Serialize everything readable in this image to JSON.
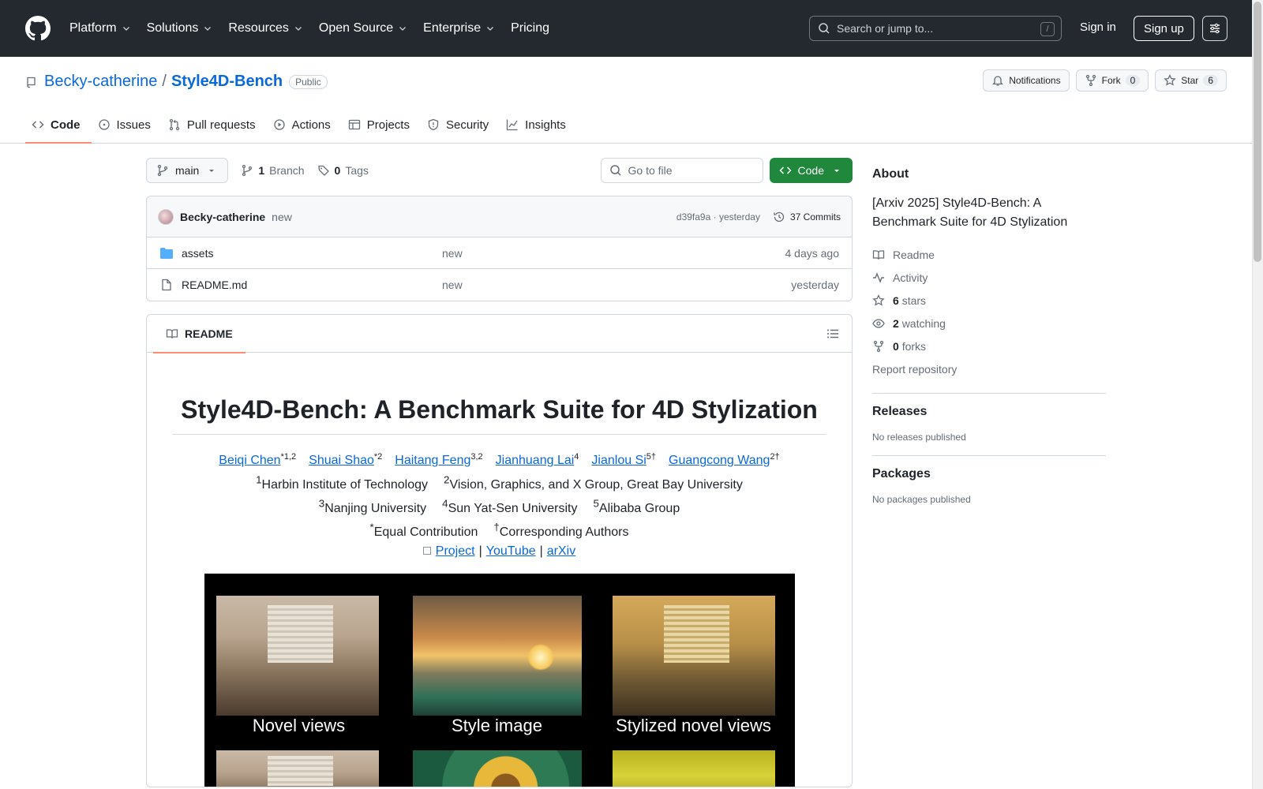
{
  "header": {
    "nav": [
      {
        "label": "Platform",
        "has_menu": true
      },
      {
        "label": "Solutions",
        "has_menu": true
      },
      {
        "label": "Resources",
        "has_menu": true
      },
      {
        "label": "Open Source",
        "has_menu": true
      },
      {
        "label": "Enterprise",
        "has_menu": true
      },
      {
        "label": "Pricing",
        "has_menu": false
      }
    ],
    "search_placeholder": "Search or jump to...",
    "search_shortcut": "/",
    "sign_in": "Sign in",
    "sign_up": "Sign up"
  },
  "repo": {
    "owner": "Becky-catherine",
    "separator": "/",
    "name": "Style4D-Bench",
    "visibility": "Public",
    "notifications_label": "Notifications",
    "fork_label": "Fork",
    "fork_count": "0",
    "star_label": "Star",
    "star_count": "6",
    "tabs": [
      {
        "label": "Code",
        "icon": "code-icon",
        "active": true
      },
      {
        "label": "Issues",
        "icon": "issue-icon"
      },
      {
        "label": "Pull requests",
        "icon": "pull-request-icon"
      },
      {
        "label": "Actions",
        "icon": "play-icon"
      },
      {
        "label": "Projects",
        "icon": "table-icon"
      },
      {
        "label": "Security",
        "icon": "shield-icon"
      },
      {
        "label": "Insights",
        "icon": "graph-icon"
      }
    ]
  },
  "toolbar": {
    "branch": "main",
    "branch_count": "1",
    "branch_label": "Branch",
    "tag_count": "0",
    "tag_label": "Tags",
    "goto_placeholder": "Go to file",
    "code_button": "Code"
  },
  "commit": {
    "author": "Becky-catherine",
    "message": "new",
    "hash_time": "d39fa9a · yesterday",
    "commits_count": "37 Commits"
  },
  "files": [
    {
      "name": "assets",
      "type": "folder",
      "message": "new",
      "date": "4 days ago"
    },
    {
      "name": "README.md",
      "type": "file",
      "message": "new",
      "date": "yesterday"
    }
  ],
  "readme": {
    "tab_label": "README",
    "title": "Style4D-Bench: A Benchmark Suite for 4D Stylization",
    "authors": [
      {
        "name": "Beiqi Chen",
        "sup": "*1,2"
      },
      {
        "name": "Shuai Shao",
        "sup": "*2"
      },
      {
        "name": "Haitang Feng",
        "sup": "3,2"
      },
      {
        "name": "Jianhuang Lai",
        "sup": "4"
      },
      {
        "name": "Jianlou Si",
        "sup": "5†"
      },
      {
        "name": "Guangcong Wang",
        "sup": "2†"
      }
    ],
    "affiliations_line1": [
      {
        "sup": "1",
        "text": "Harbin Institute of Technology"
      },
      {
        "sup": "2",
        "text": "Vision, Graphics, and X Group, Great Bay University"
      }
    ],
    "affiliations_line2": [
      {
        "sup": "3",
        "text": "Nanjing University"
      },
      {
        "sup": "4",
        "text": "Sun Yat-Sen University"
      },
      {
        "sup": "5",
        "text": "Alibaba Group"
      }
    ],
    "notes": [
      {
        "sup": "*",
        "text": "Equal Contribution"
      },
      {
        "sup": "†",
        "text": "Corresponding Authors"
      }
    ],
    "links": [
      "Project",
      "YouTube",
      "arXiv"
    ],
    "link_sep": "|",
    "captions": [
      "Novel views",
      "Style image",
      "Stylized novel views"
    ]
  },
  "sidebar": {
    "about_title": "About",
    "description": "[Arxiv 2025] Style4D-Bench: A Benchmark Suite for 4D Stylization",
    "readme": "Readme",
    "activity": "Activity",
    "stars_count": "6",
    "stars_label": "stars",
    "watching_count": "2",
    "watching_label": "watching",
    "forks_count": "0",
    "forks_label": "forks",
    "report": "Report repository",
    "releases_title": "Releases",
    "releases_empty": "No releases published",
    "packages_title": "Packages",
    "packages_empty": "No packages published"
  }
}
